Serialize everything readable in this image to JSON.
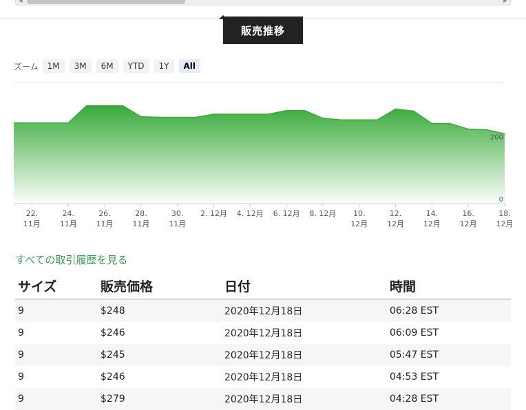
{
  "section_title": "販売推移",
  "zoom": {
    "label": "ズーム",
    "buttons": [
      "1M",
      "3M",
      "6M",
      "YTD",
      "1Y",
      "All"
    ],
    "active": "All"
  },
  "chart_data": {
    "type": "area",
    "x": [
      "11/21",
      "11/22",
      "11/23",
      "11/24",
      "11/25",
      "11/26",
      "11/27",
      "11/28",
      "11/29",
      "11/30",
      "12/01",
      "12/02",
      "12/03",
      "12/04",
      "12/05",
      "12/06",
      "12/07",
      "12/08",
      "12/09",
      "12/10",
      "12/11",
      "12/12",
      "12/13",
      "12/14",
      "12/15",
      "12/16",
      "12/17",
      "12/18"
    ],
    "values": [
      260,
      260,
      260,
      260,
      315,
      315,
      315,
      280,
      278,
      278,
      278,
      288,
      288,
      288,
      288,
      300,
      300,
      275,
      270,
      270,
      270,
      305,
      298,
      258,
      258,
      240,
      238,
      225
    ],
    "xticks": [
      {
        "line1": "22.",
        "line2": "11月"
      },
      {
        "line1": "24.",
        "line2": "11月"
      },
      {
        "line1": "26.",
        "line2": "11月"
      },
      {
        "line1": "28.",
        "line2": "11月"
      },
      {
        "line1": "30.",
        "line2": "11月"
      },
      {
        "line1": "2. 12月",
        "line2": ""
      },
      {
        "line1": "4. 12月",
        "line2": ""
      },
      {
        "line1": "6. 12月",
        "line2": ""
      },
      {
        "line1": "8. 12月",
        "line2": ""
      },
      {
        "line1": "10.",
        "line2": "12月"
      },
      {
        "line1": "12.",
        "line2": "12月"
      },
      {
        "line1": "14.",
        "line2": "12月"
      },
      {
        "line1": "16.",
        "line2": "12月"
      },
      {
        "line1": "18.",
        "line2": "12月"
      }
    ],
    "ytick_labels": [
      "200",
      "0"
    ],
    "ytick_values": [
      200,
      0
    ],
    "ylim": [
      0,
      390
    ],
    "color": "#3aaa3a",
    "grid": true
  },
  "history_link": "すべての取引履歴を見る",
  "table": {
    "headers": [
      "サイズ",
      "販売価格",
      "日付",
      "時間"
    ],
    "rows": [
      [
        "9",
        "$248",
        "2020年12月18日",
        "06:28 EST"
      ],
      [
        "9",
        "$246",
        "2020年12月18日",
        "06:09 EST"
      ],
      [
        "9",
        "$245",
        "2020年12月18日",
        "05:47 EST"
      ],
      [
        "9",
        "$246",
        "2020年12月18日",
        "04:53 EST"
      ],
      [
        "9",
        "$279",
        "2020年12月18日",
        "04:28 EST"
      ]
    ]
  }
}
